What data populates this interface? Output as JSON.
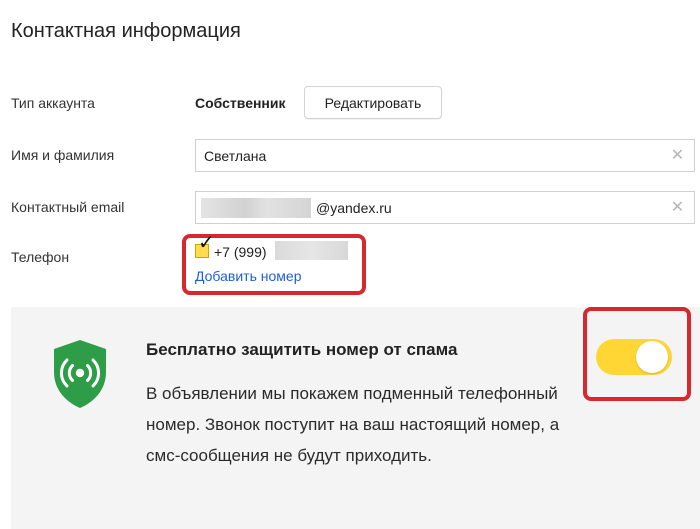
{
  "page": {
    "title": "Контактная информация"
  },
  "account_type": {
    "label": "Тип аккаунта",
    "value": "Собственник",
    "edit_label": "Редактировать"
  },
  "name": {
    "label": "Имя и фамилия",
    "value": "Светлана",
    "clear_icon": "close-icon"
  },
  "email": {
    "label": "Контактный email",
    "value": "@yandex.ru",
    "clear_icon": "close-icon"
  },
  "phone": {
    "label": "Телефон",
    "number": "+7 (999)",
    "checked": true,
    "add_label": "Добавить номер"
  },
  "spam_protection": {
    "title": "Бесплатно защитить номер от спама",
    "description": "В объявлении мы покажем подменный телефонный номер. Звонок поступит на ваш настоящий номер, а смс-сообщения не будут приходить.",
    "enabled": true,
    "icon": "shield-signal-icon",
    "colors": {
      "shield": "#2e9d47",
      "toggle": "#ffd633",
      "highlight": "#d8282f",
      "link": "#1f5fd6"
    }
  }
}
